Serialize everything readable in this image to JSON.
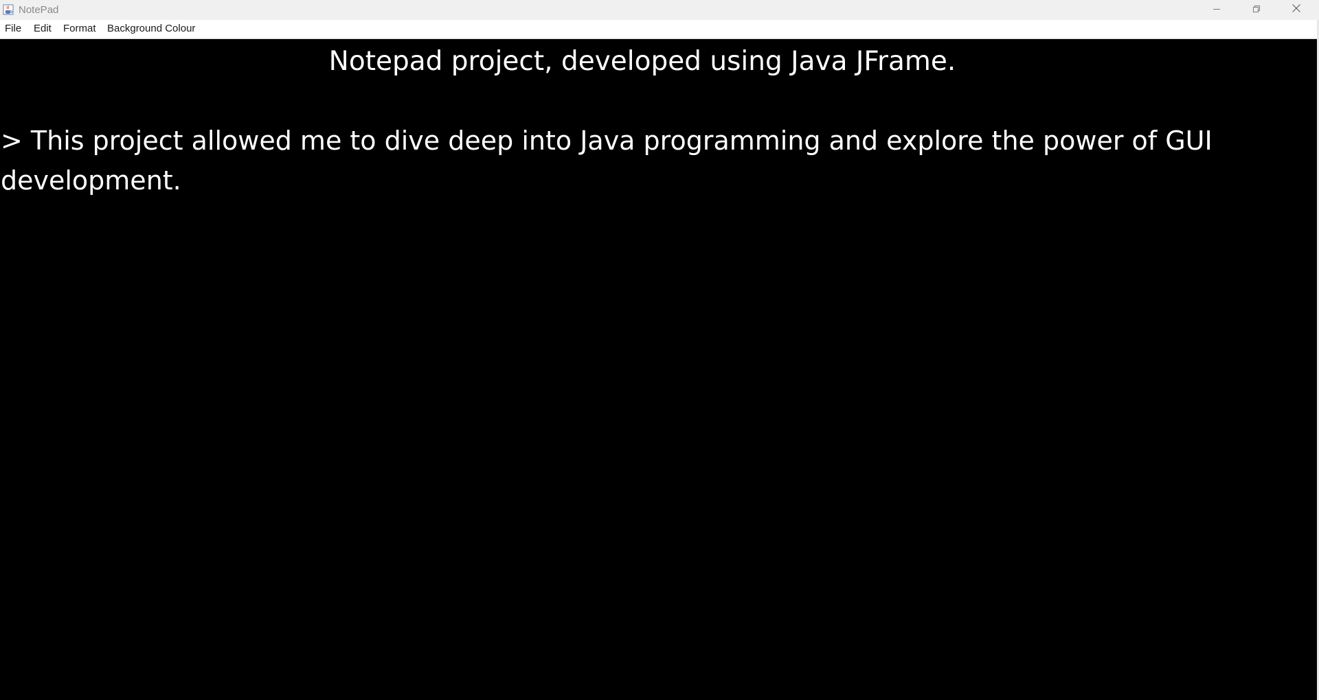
{
  "window": {
    "title": "NotePad",
    "app_icon": "java-cup-icon",
    "controls": {
      "minimize_icon": "minimize-icon",
      "maximize_icon": "restore-icon",
      "close_icon": "close-icon"
    }
  },
  "menubar": {
    "file_label": "File",
    "edit_label": "Edit",
    "format_label": "Format",
    "background_label": "Background Colour"
  },
  "editor": {
    "background_color": "#000000",
    "text_color": "#ffffff",
    "heading": "Notepad project, developed using Java JFrame.",
    "paragraph": "> This project allowed me to dive deep into Java programming and explore the power of GUI development."
  }
}
